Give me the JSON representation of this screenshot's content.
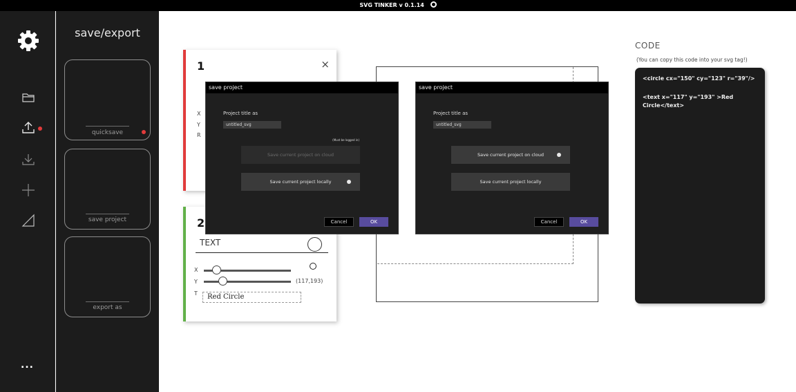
{
  "app": {
    "title": "SVG TINKER v 0.1.14",
    "github_icon": "github-icon"
  },
  "rail": {
    "icons": [
      "gear-icon",
      "folder-icon",
      "upload-icon",
      "download-icon",
      "plus-icon",
      "triangle-icon",
      "more-icon"
    ],
    "more_label": "..."
  },
  "panel": {
    "title": "save/export",
    "slots": [
      {
        "label": "quicksave",
        "status_dot": true
      },
      {
        "label": "save project"
      },
      {
        "label": "export as"
      }
    ]
  },
  "shapes": [
    {
      "number": "1",
      "close_label": "×",
      "props": [
        "X",
        "Y",
        "R"
      ],
      "color": "#e03b3b"
    },
    {
      "number": "2",
      "type_label": "TEXT",
      "props": [
        "X",
        "Y",
        "T"
      ],
      "coord_label": "(117,193)",
      "text_value": "Red Circle",
      "color": "#62b049"
    }
  ],
  "dialogs": [
    {
      "title": "save project",
      "label": "Project title as",
      "input_value": "untitled_svg",
      "note": "(Must be logged in)",
      "cloud_button": "Save current project on cloud",
      "local_button": "Save current project locally",
      "selected": "local",
      "cancel": "Cancel",
      "ok": "OK"
    },
    {
      "title": "save project",
      "label": "Project title as",
      "input_value": "untitled_svg",
      "cloud_button": "Save current project on cloud",
      "local_button": "Save current project locally",
      "selected": "cloud",
      "cancel": "Cancel",
      "ok": "OK"
    }
  ],
  "code": {
    "title": "CODE",
    "subtitle": "(You can copy this code into your svg tag!)",
    "lines": [
      "<circle cx=\"150\" cy=\"123\" r=\"39\"/>",
      "<text x=\"117\" y=\"193\" >Red",
      "Circle</text>"
    ]
  },
  "colors": {
    "accent": "#584c9e",
    "danger": "#e23b3b",
    "success": "#62b049",
    "dark": "#1c1c1c"
  }
}
